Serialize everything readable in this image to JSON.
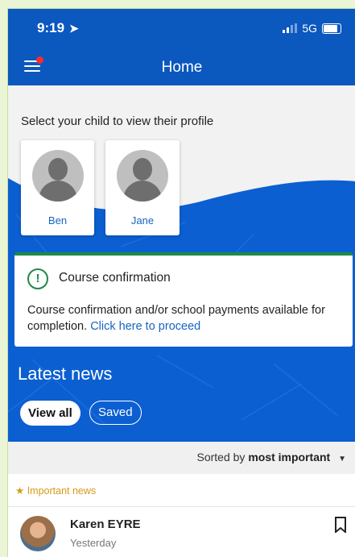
{
  "status": {
    "time": "9:19",
    "location_glyph": "➤",
    "network": "5G"
  },
  "header": {
    "title": "Home"
  },
  "children_section": {
    "prompt": "Select your child to view their profile",
    "children": [
      {
        "name": "Ben"
      },
      {
        "name": "Jane"
      }
    ]
  },
  "course": {
    "title": "Course confirmation",
    "body": "Course confirmation and/or school payments available for completion.",
    "link": "Click here to proceed"
  },
  "news": {
    "heading": "Latest news",
    "filters": [
      {
        "label": "View all",
        "selected": true
      },
      {
        "label": "Saved",
        "selected": false
      }
    ],
    "sort_prefix": "Sorted by",
    "sort_value": "most important",
    "section_label": "Important news",
    "items": [
      {
        "author": "Karen EYRE",
        "date": "Yesterday"
      }
    ]
  },
  "colors": {
    "brand_blue": "#0b58bf",
    "accent_green": "#1e8a48",
    "important_gold": "#d59a17",
    "link_blue": "#1565c0"
  },
  "icons": [
    "location-arrow-icon",
    "signal-icon",
    "battery-icon",
    "menu-icon",
    "notification-dot-icon",
    "alert-circle-icon",
    "star-icon",
    "bookmark-icon",
    "caret-down-icon"
  ]
}
